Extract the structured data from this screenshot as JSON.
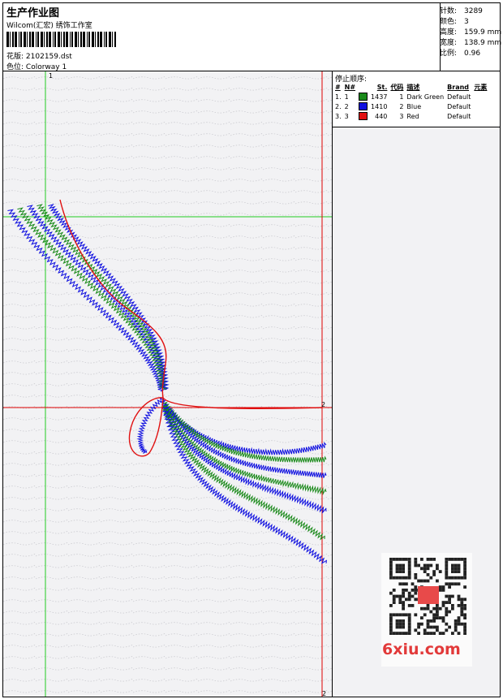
{
  "header": {
    "title": "生产作业图",
    "company": "Wilcom(汇宏) 绣饰工作室",
    "design_label": "花版:",
    "design_value": "2102159.dst",
    "colorway_label": "色位:",
    "colorway_value": "Colorway 1"
  },
  "stats": [
    {
      "label": "针数:",
      "value": "3289"
    },
    {
      "label": "颜色:",
      "value": "3"
    },
    {
      "label": "高度:",
      "value": "159.9 mm"
    },
    {
      "label": "宽度:",
      "value": "138.9 mm"
    },
    {
      "label": "比例:",
      "value": "0.96"
    }
  ],
  "stop_sequence": {
    "title": "停止顺序:",
    "headers": [
      "#",
      "N#",
      "St.",
      "代码",
      "描述",
      "Brand",
      "元素"
    ],
    "rows": [
      {
        "idx": "1.",
        "n": "1",
        "color": "#1a8a1a",
        "stitches": "1437",
        "code": "1",
        "desc": "Dark Green",
        "brand": "Default"
      },
      {
        "idx": "2.",
        "n": "2",
        "color": "#1010e0",
        "stitches": "1410",
        "code": "2",
        "desc": "Blue",
        "brand": "Default"
      },
      {
        "idx": "3.",
        "n": "3",
        "color": "#e01010",
        "stitches": "440",
        "code": "3",
        "desc": "Red",
        "brand": "Default"
      }
    ]
  },
  "canvas": {
    "marker_top": "1",
    "marker_mid": "2",
    "marker_bottom": "2"
  },
  "watermark": {
    "site": "6xiu.com"
  },
  "colors": {
    "green": "#1a8a1a",
    "blue": "#1010e0",
    "red": "#e01010",
    "guide_green": "#22cc22",
    "guide_red": "#dd0000"
  }
}
